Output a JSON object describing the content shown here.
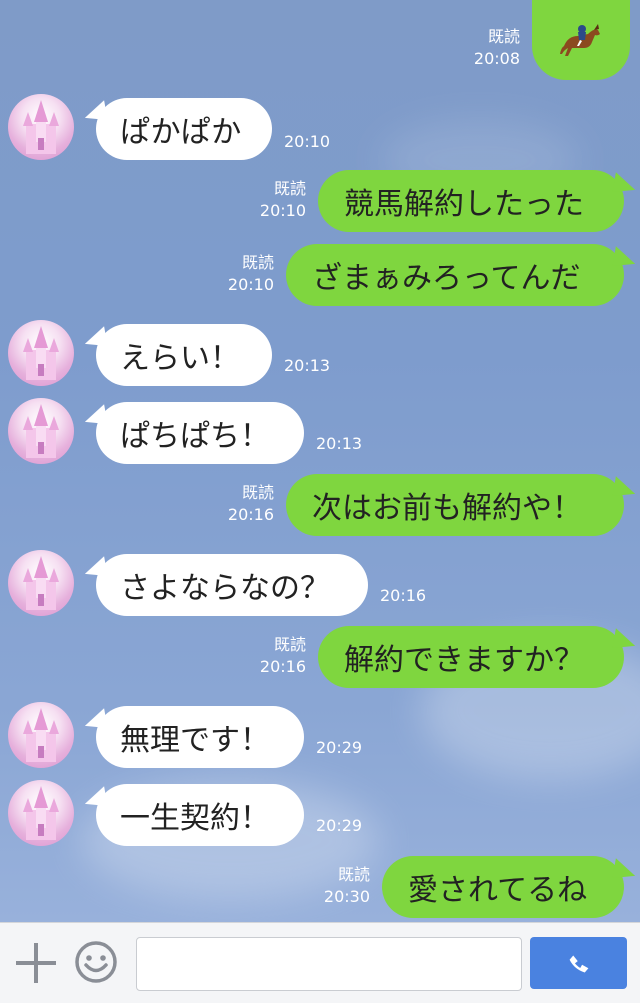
{
  "colors": {
    "accent_green": "#7fd63f",
    "send_blue": "#4a82e0",
    "background": "#7f9bc8"
  },
  "messages": [
    {
      "side": "out",
      "kind": "sticker",
      "icon": "horse-racing-emoji",
      "read": "既読",
      "time": "20:08"
    },
    {
      "side": "in",
      "text": "ぱかぱか",
      "time": "20:10"
    },
    {
      "side": "out",
      "text": "競馬解約したった",
      "read": "既読",
      "time": "20:10"
    },
    {
      "side": "out",
      "text": "ざまぁみろってんだ",
      "read": "既読",
      "time": "20:10"
    },
    {
      "side": "in",
      "text": "えらい！",
      "time": "20:13"
    },
    {
      "side": "in",
      "text": "ぱちぱち！",
      "time": "20:13"
    },
    {
      "side": "out",
      "text": "次はお前も解約や！",
      "read": "既読",
      "time": "20:16"
    },
    {
      "side": "in",
      "text": "さよならなの？",
      "time": "20:16"
    },
    {
      "side": "out",
      "text": "解約できますか？",
      "read": "既読",
      "time": "20:16"
    },
    {
      "side": "in",
      "text": "無理です！",
      "time": "20:29"
    },
    {
      "side": "in",
      "text": "一生契約！",
      "time": "20:29"
    },
    {
      "side": "out",
      "text": "愛されてるね",
      "read": "既読",
      "time": "20:30"
    }
  ],
  "input_bar": {
    "plus_icon": "plus-icon",
    "sticker_icon": "smiley-icon",
    "message_value": "",
    "call_icon": "phone-icon"
  }
}
